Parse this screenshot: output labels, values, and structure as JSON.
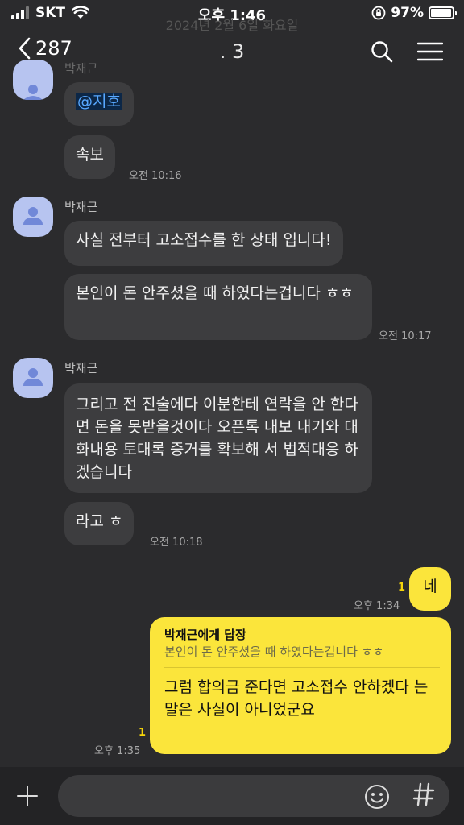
{
  "status_bar": {
    "carrier": "SKT",
    "time": "오후 1:46",
    "battery": "97%",
    "battery_level": 0.97
  },
  "header": {
    "back_count": "287",
    "title": ". 3",
    "date_divider": "2024년 2월 6일 화요일"
  },
  "messages": [
    {
      "sender": "박재근",
      "text": "@지호"
    },
    {
      "text": "속보",
      "time": "오전 10:16"
    },
    {
      "sender": "박재근",
      "text": "사실 전부터 고소접수를 한 상태 입니다!"
    },
    {
      "text": "본인이 돈 안주셨을 때 하였다는겁니다 ㅎㅎ",
      "time": "오전 10:17"
    },
    {
      "sender": "박재근",
      "text": "그리고 전 진술에다 이분한테 연락을 안 한다면 돈을 못받을것이다 오픈톡 내보 내기와 대화내용 토대록 증거를 확보해 서 법적대응 하겠습니다"
    },
    {
      "text": "라고 ㅎ",
      "time": "오전 10:18"
    },
    {
      "text": "네",
      "time": "오후 1:34",
      "unread": "1"
    },
    {
      "reply_to_label": "박재근에게 답장",
      "reply_to_text": "본인이 돈 안주셨을 때 하였다는겁니다 ㅎㅎ",
      "text": "그럼 합의금 준다면 고소접수 안하겠다 는 말은 사실이 아니었군요",
      "time": "오후 1:35",
      "unread": "1"
    }
  ],
  "input": {
    "placeholder": "",
    "value": ""
  },
  "colors": {
    "my_bubble": "#fbe53b",
    "other_bubble": "#3d3d3f",
    "background": "#2b2b2d",
    "unread": "#f6d50a"
  },
  "icons": [
    "back-chevron-icon",
    "search-icon",
    "menu-icon",
    "plus-icon",
    "emoji-icon",
    "hash-icon",
    "avatar-person-icon"
  ]
}
